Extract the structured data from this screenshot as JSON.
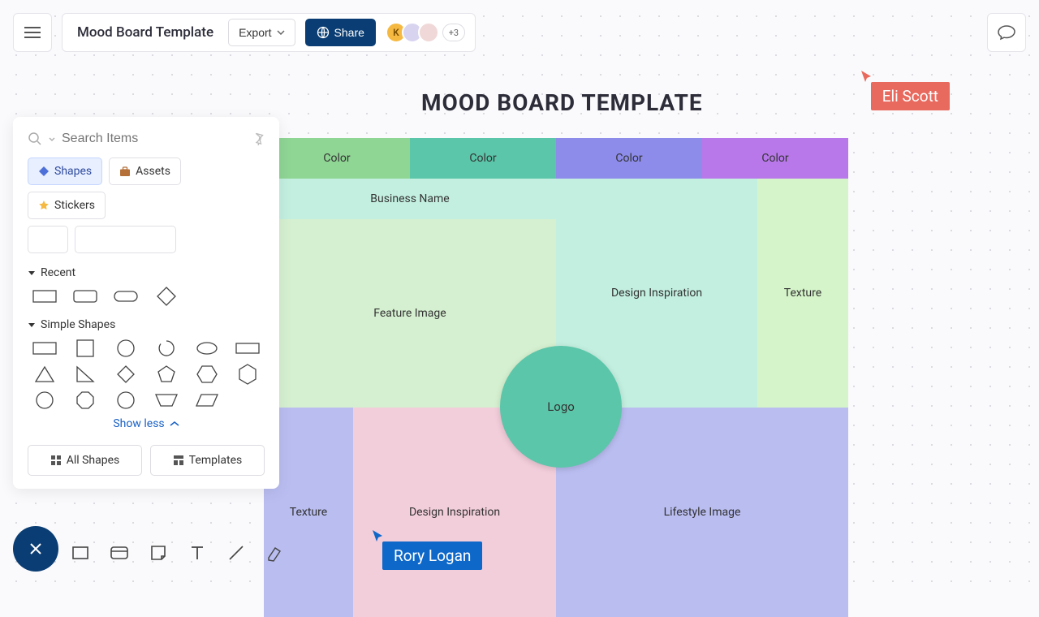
{
  "header": {
    "title": "Mood Board Template",
    "export_label": "Export",
    "share_label": "Share",
    "avatar_k": "K",
    "more_count": "+3"
  },
  "panel": {
    "search_placeholder": "Search Items",
    "tabs": {
      "shapes": "Shapes",
      "assets": "Assets",
      "stickers": "Stickers"
    },
    "section_recent": "Recent",
    "section_simple": "Simple Shapes",
    "show_less": "Show less",
    "all_shapes": "All Shapes",
    "templates": "Templates"
  },
  "board": {
    "title": "MOOD BOARD TEMPLATE",
    "color_label": "Color",
    "business_name": "Business Name",
    "feature_image": "Feature Image",
    "design_inspiration": "Design Inspiration",
    "texture": "Texture",
    "lifestyle": "Lifestyle Image",
    "logo": "Logo"
  },
  "presence": {
    "eli": "Eli Scott",
    "rory": "Rory Logan"
  }
}
